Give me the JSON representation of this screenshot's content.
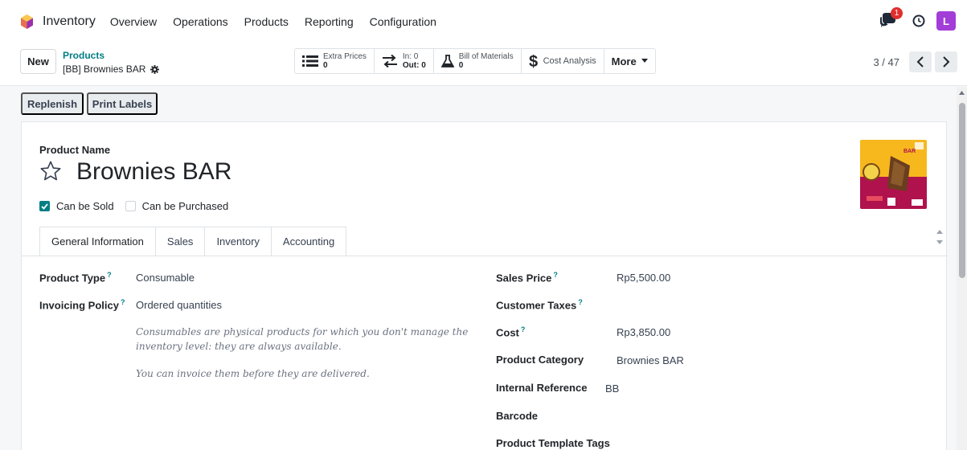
{
  "nav": {
    "app_name": "Inventory",
    "menu": [
      "Overview",
      "Operations",
      "Products",
      "Reporting",
      "Configuration"
    ],
    "notification_count": "1",
    "avatar_letter": "L"
  },
  "control": {
    "new_label": "New",
    "breadcrumb_parent": "Products",
    "breadcrumb_current": "[BB] Brownies BAR",
    "pager": "3 / 47",
    "smart_buttons": {
      "extra_prices_label": "Extra Prices",
      "extra_prices_value": "0",
      "in_label": "In: 0",
      "out_label": "Out: 0",
      "bom_label": "Bill of Materials",
      "bom_value": "0",
      "cost_analysis_label": "Cost Analysis",
      "more_label": "More"
    }
  },
  "actions": {
    "replenish": "Replenish",
    "print_labels": "Print Labels"
  },
  "product": {
    "name_label": "Product Name",
    "name": "Brownies BAR",
    "can_be_sold_label": "Can be Sold",
    "can_be_sold": true,
    "can_be_purchased_label": "Can be Purchased",
    "can_be_purchased": false,
    "image_text": "BAR"
  },
  "tabs": [
    "General Information",
    "Sales",
    "Inventory",
    "Accounting"
  ],
  "general": {
    "product_type_label": "Product Type",
    "product_type": "Consumable",
    "invoicing_policy_label": "Invoicing Policy",
    "invoicing_policy": "Ordered quantities",
    "help_line1": "Consumables are physical products for which you don't manage the",
    "help_line2": "inventory level: they are always available.",
    "help_line3": "You can invoice them before they are delivered.",
    "sales_price_label": "Sales Price",
    "sales_price": "Rp5,500.00",
    "customer_taxes_label": "Customer Taxes",
    "cost_label": "Cost",
    "cost": "Rp3,850.00",
    "product_category_label": "Product Category",
    "product_category": "Brownies BAR",
    "internal_reference_label": "Internal Reference",
    "internal_reference": "BB",
    "barcode_label": "Barcode",
    "template_tags_label": "Product Template Tags",
    "help_mark": "?"
  },
  "colors": {
    "accent": "#017e84",
    "avatar": "#a23dd8",
    "badge": "#e02e2e"
  }
}
